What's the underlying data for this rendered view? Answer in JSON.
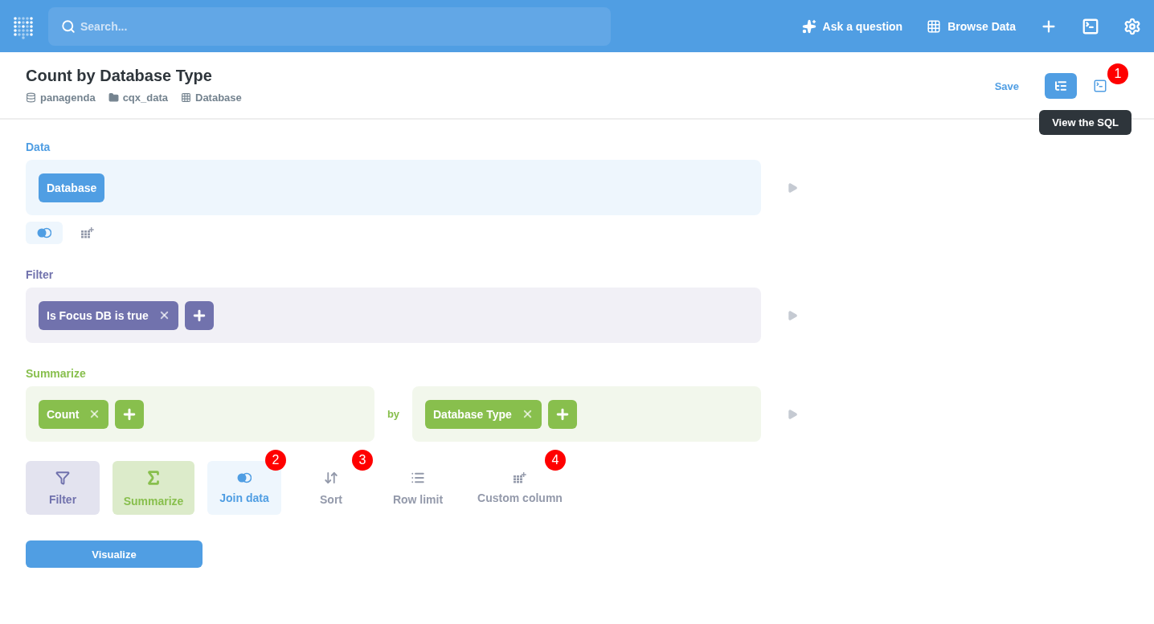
{
  "navbar": {
    "search": {
      "placeholder": "Search..."
    },
    "actions": [
      {
        "kind": "ask",
        "label": "Ask a question"
      },
      {
        "kind": "browse",
        "label": "Browse Data"
      }
    ]
  },
  "header": {
    "title": "Count by Database Type",
    "breadcrumbs": [
      {
        "kind": "database",
        "label": "panagenda"
      },
      {
        "kind": "folder",
        "label": "cqx_data"
      },
      {
        "kind": "table",
        "label": "Database"
      }
    ],
    "save": "Save",
    "editor_toggle_selected": true,
    "sql_badge": "1",
    "tooltip": "View the SQL"
  },
  "steps": [
    {
      "kind": "data",
      "label": "Data",
      "tokens": [
        {
          "label": "Database",
          "removable": false
        }
      ],
      "extras": [
        {
          "kind": "join",
          "selected": true
        },
        {
          "kind": "custom",
          "selected": false
        }
      ]
    },
    {
      "kind": "filter",
      "label": "Filter",
      "tokens": [
        {
          "label": "Is Focus DB is true",
          "removable": true
        }
      ]
    },
    {
      "kind": "summarize",
      "label": "Summarize",
      "tokens": [
        {
          "label": "Count",
          "removable": true
        }
      ],
      "by": "by",
      "group_tokens": [
        {
          "label": "Database Type",
          "removable": true
        }
      ]
    }
  ],
  "actions": [
    {
      "kind": "filter",
      "label": "Filter"
    },
    {
      "kind": "summarize",
      "label": "Summarize"
    },
    {
      "kind": "join",
      "label": "Join data",
      "badge": "2"
    },
    {
      "kind": "sort",
      "label": "Sort",
      "badge": "3"
    },
    {
      "kind": "limit",
      "label": "Row limit"
    },
    {
      "kind": "custom",
      "label": "Custom column",
      "badge": "4"
    }
  ],
  "visualize": "Visualize"
}
